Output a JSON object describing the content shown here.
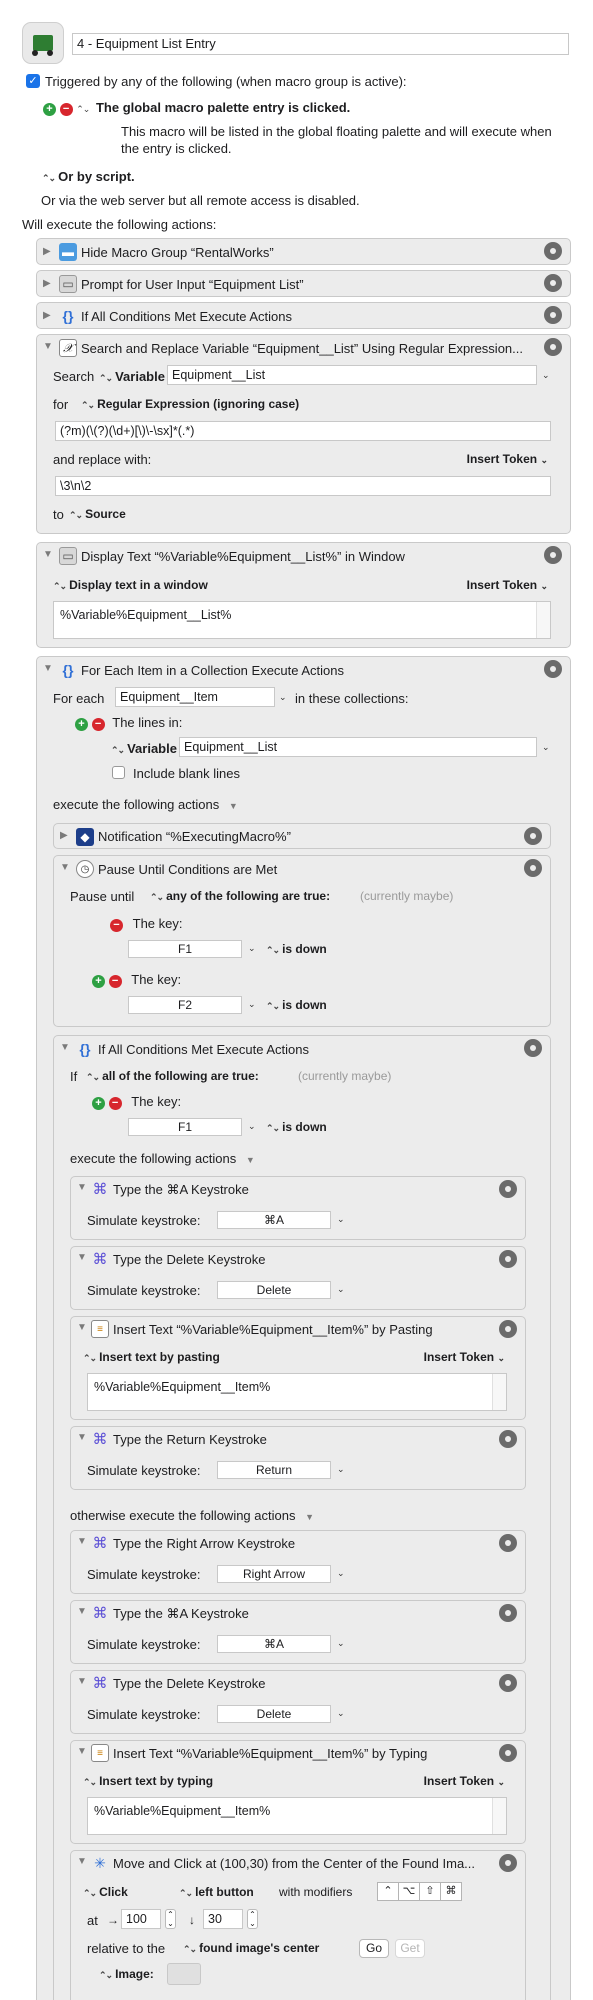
{
  "macro": {
    "name": "4 - Equipment List Entry",
    "trigger_label": "Triggered by any of the following (when macro group is active):",
    "palette_trigger": "The global macro palette entry is clicked.",
    "palette_desc": "This macro will be listed in the global floating palette and will execute when the entry is clicked.",
    "or_by_script": "Or by script.",
    "web_server": "Or via the web server but all remote access is disabled.",
    "will_execute": "Will execute the following actions:"
  },
  "actions": {
    "a1": "Hide Macro Group “RentalWorks”",
    "a2": "Prompt for User Input “Equipment List”",
    "a3": "If All Conditions Met Execute Actions",
    "search": {
      "title": "Search and Replace Variable “Equipment__List” Using Regular Expression...",
      "search_label": "Search",
      "variable_label": "Variable",
      "variable_value": "Equipment__List",
      "for_label": "for",
      "regex_type": "Regular Expression (ignoring case)",
      "regex_value": "(?m)(\\(?)(\\d+)[\\)\\-\\sx]*(.*)",
      "replace_label": "and replace with:",
      "insert_token": "Insert Token",
      "replace_value": "\\3\\n\\2",
      "to_label": "to",
      "to_value": "Source"
    },
    "display": {
      "title": "Display Text “%Variable%Equipment__List%” in Window",
      "mode": "Display text in a window",
      "insert_token": "Insert Token",
      "text": "%Variable%Equipment__List%"
    },
    "foreach": {
      "title": "For Each Item in a Collection Execute Actions",
      "for_each": "For each",
      "item_var": "Equipment__Item",
      "in_collections": "in these collections:",
      "lines_in": "The lines in:",
      "variable_label": "Variable",
      "variable_value": "Equipment__List",
      "include_blank": "Include blank lines",
      "execute_label": "execute the following actions"
    },
    "notification": "Notification “%ExecutingMacro%”",
    "pause": {
      "title": "Pause Until Conditions are Met",
      "pause_until": "Pause until",
      "any_of": "any of the following are true:",
      "status": "(currently maybe)",
      "key_label1": "The key:",
      "key1": "F1",
      "is_down1": "is down",
      "key_label2": "The key:",
      "key2": "F2",
      "is_down2": "is down"
    },
    "ifall": {
      "title": "If All Conditions Met Execute Actions",
      "if_label": "If",
      "all_of": "all of the following are true:",
      "status": "(currently maybe)",
      "key_label": "The key:",
      "key": "F1",
      "is_down": "is down",
      "execute_label": "execute the following actions",
      "otherwise_label": "otherwise execute the following actions"
    },
    "k1": {
      "title": "Type the ⌘A Keystroke",
      "label": "Simulate keystroke:",
      "key": "⌘A"
    },
    "k2": {
      "title": "Type the Delete Keystroke",
      "label": "Simulate keystroke:",
      "key": "Delete"
    },
    "ins1": {
      "title": "Insert Text “%Variable%Equipment__Item%” by Pasting",
      "mode": "Insert text by pasting",
      "insert_token": "Insert Token",
      "text": "%Variable%Equipment__Item%"
    },
    "k3": {
      "title": "Type the Return Keystroke",
      "label": "Simulate keystroke:",
      "key": "Return"
    },
    "k4": {
      "title": "Type the Right Arrow Keystroke",
      "label": "Simulate keystroke:",
      "key": "Right Arrow"
    },
    "k5": {
      "title": "Type the ⌘A Keystroke",
      "label": "Simulate keystroke:",
      "key": "⌘A"
    },
    "k6": {
      "title": "Type the Delete Keystroke",
      "label": "Simulate keystroke:",
      "key": "Delete"
    },
    "ins2": {
      "title": "Insert Text “%Variable%Equipment__Item%” by Typing",
      "mode": "Insert text by typing",
      "insert_token": "Insert Token",
      "text": "%Variable%Equipment__Item%"
    },
    "move": {
      "title": "Move and Click at (100,30) from the Center of the Found Ima...",
      "click": "Click",
      "button": "left button",
      "with_mods": "with modifiers",
      "mods": [
        "⌃",
        "⌥",
        "⇧",
        "⌘"
      ],
      "at": "at",
      "right_arrow": "→",
      "x": "100",
      "down_arrow": "↓",
      "y": "30",
      "relative": "relative to the",
      "relative_value": "found image's center",
      "go": "Go",
      "get": "Get",
      "image_label": "Image:"
    }
  }
}
